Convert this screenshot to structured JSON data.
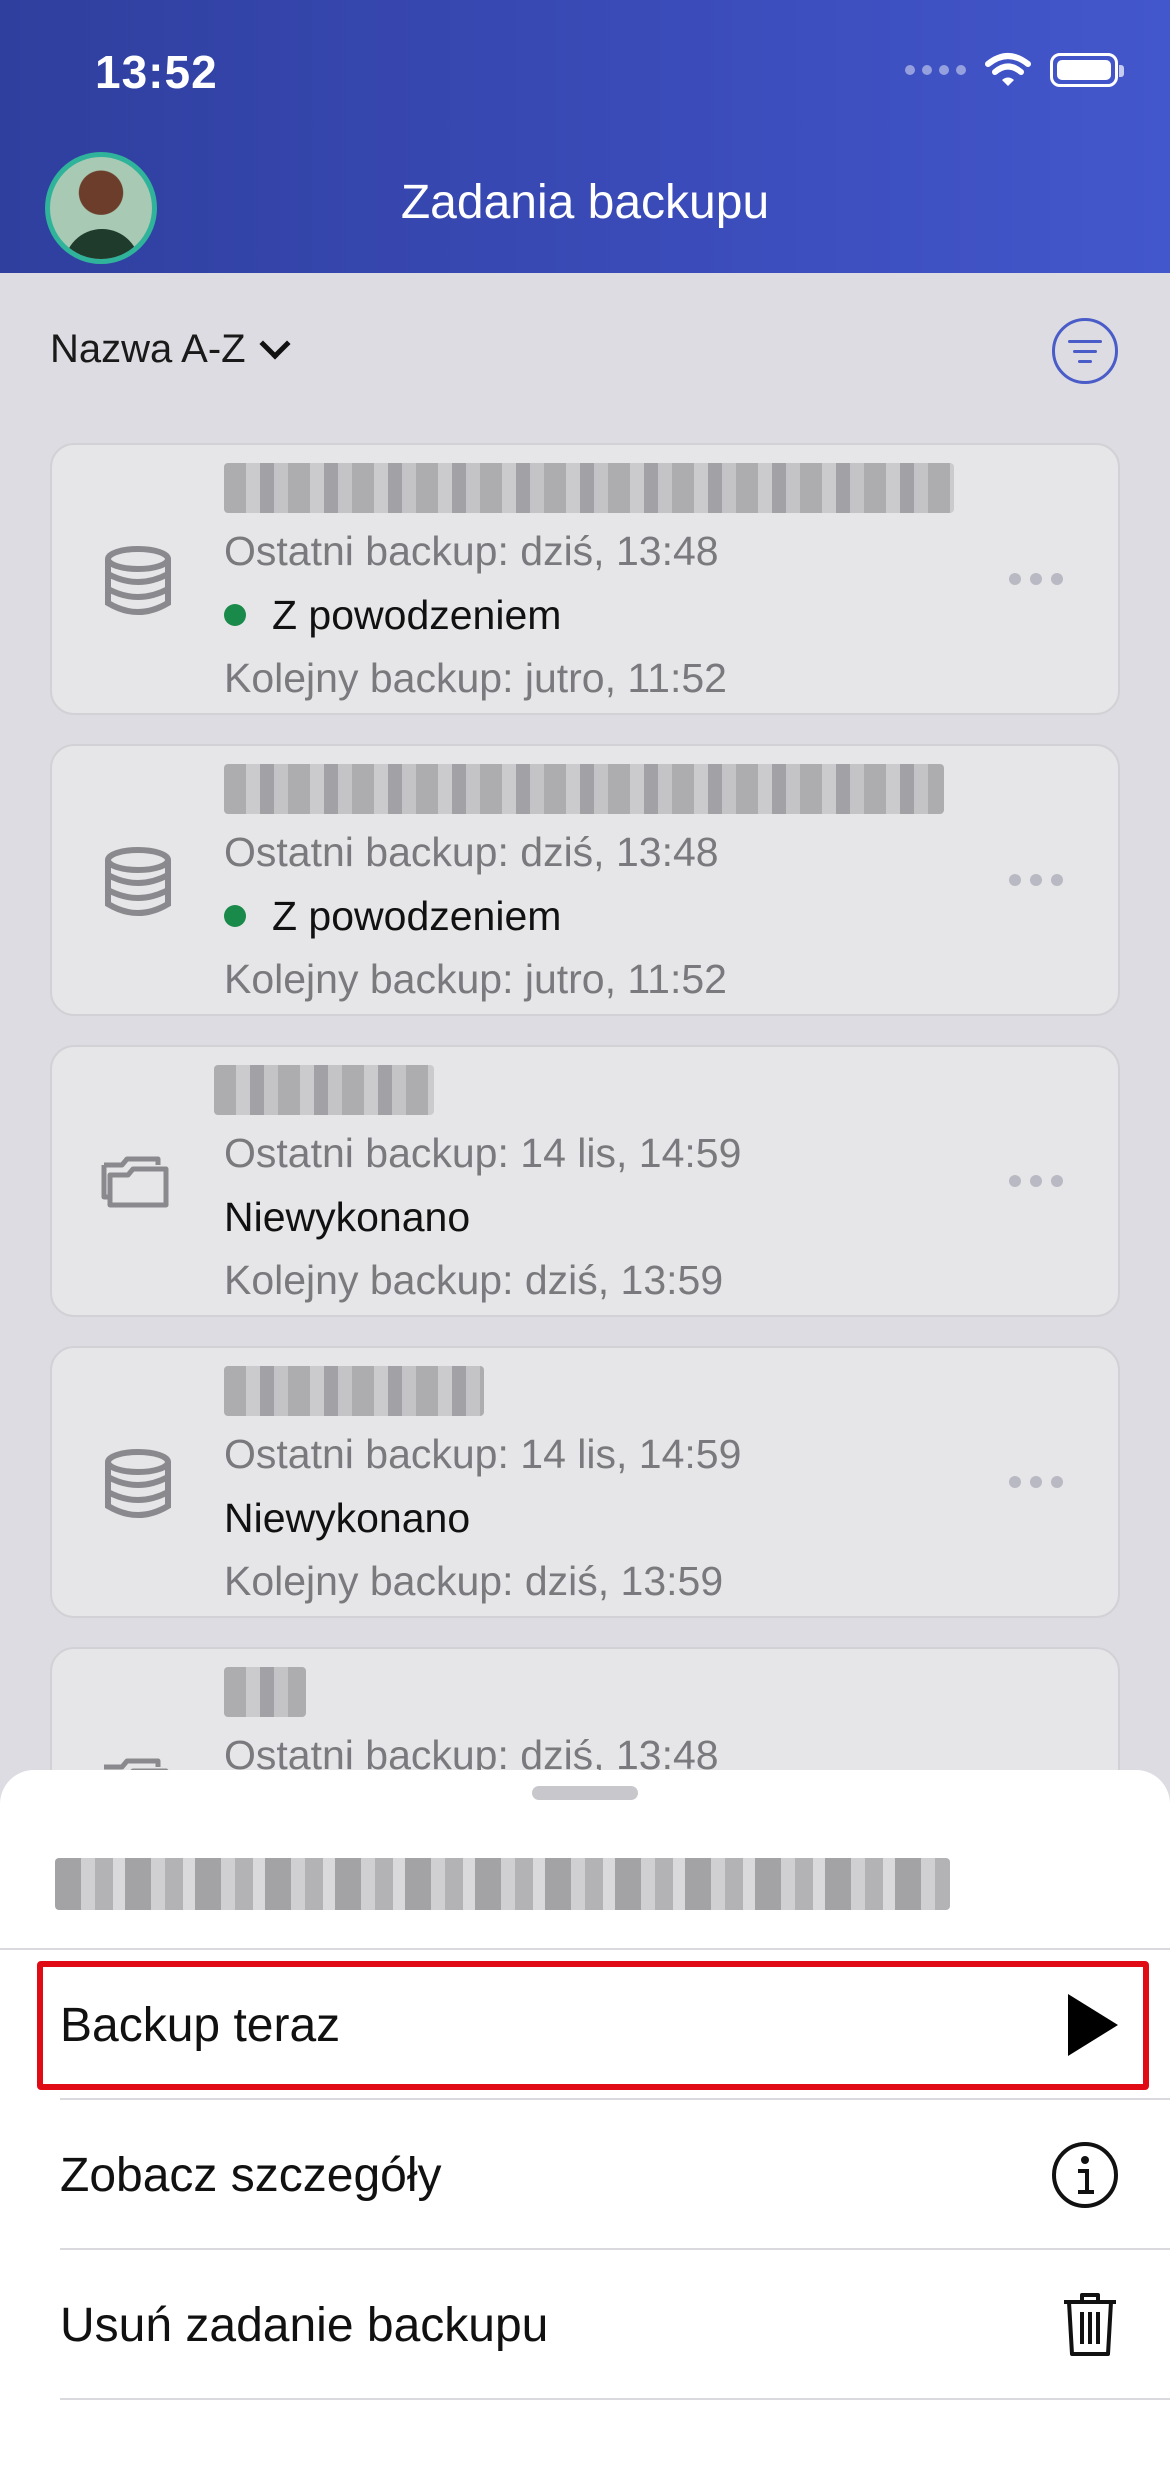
{
  "status_bar": {
    "time": "13:52"
  },
  "header": {
    "title": "Zadania backupu"
  },
  "sort": {
    "label": "Nazwa A-Z"
  },
  "jobs": [
    {
      "type": "database",
      "last": "Ostatni backup: dziś, 13:48",
      "status": "Z powodzeniem",
      "status_success": true,
      "next": "Kolejny backup: jutro, 11:52"
    },
    {
      "type": "database",
      "last": "Ostatni backup: dziś, 13:48",
      "status": "Z powodzeniem",
      "status_success": true,
      "next": "Kolejny backup: jutro, 11:52"
    },
    {
      "type": "folder",
      "last": "Ostatni backup: 14 lis, 14:59",
      "status": "Niewykonano",
      "status_success": false,
      "next": "Kolejny backup: dziś, 13:59"
    },
    {
      "type": "database",
      "last": "Ostatni backup: 14 lis, 14:59",
      "status": "Niewykonano",
      "status_success": false,
      "next": "Kolejny backup: dziś, 13:59"
    },
    {
      "type": "folder",
      "last": "Ostatni backup: dziś, 13:48"
    }
  ],
  "sheet": {
    "actions": [
      {
        "label": "Backup teraz",
        "icon": "play-icon"
      },
      {
        "label": "Zobacz szczegóły",
        "icon": "info-icon"
      },
      {
        "label": "Usuń zadanie backupu",
        "icon": "trash-icon"
      }
    ]
  },
  "colors": {
    "header": "#3a4bb8",
    "accent": "#4a5cc8",
    "success": "#1a8a4a",
    "highlight": "#e00b14"
  }
}
